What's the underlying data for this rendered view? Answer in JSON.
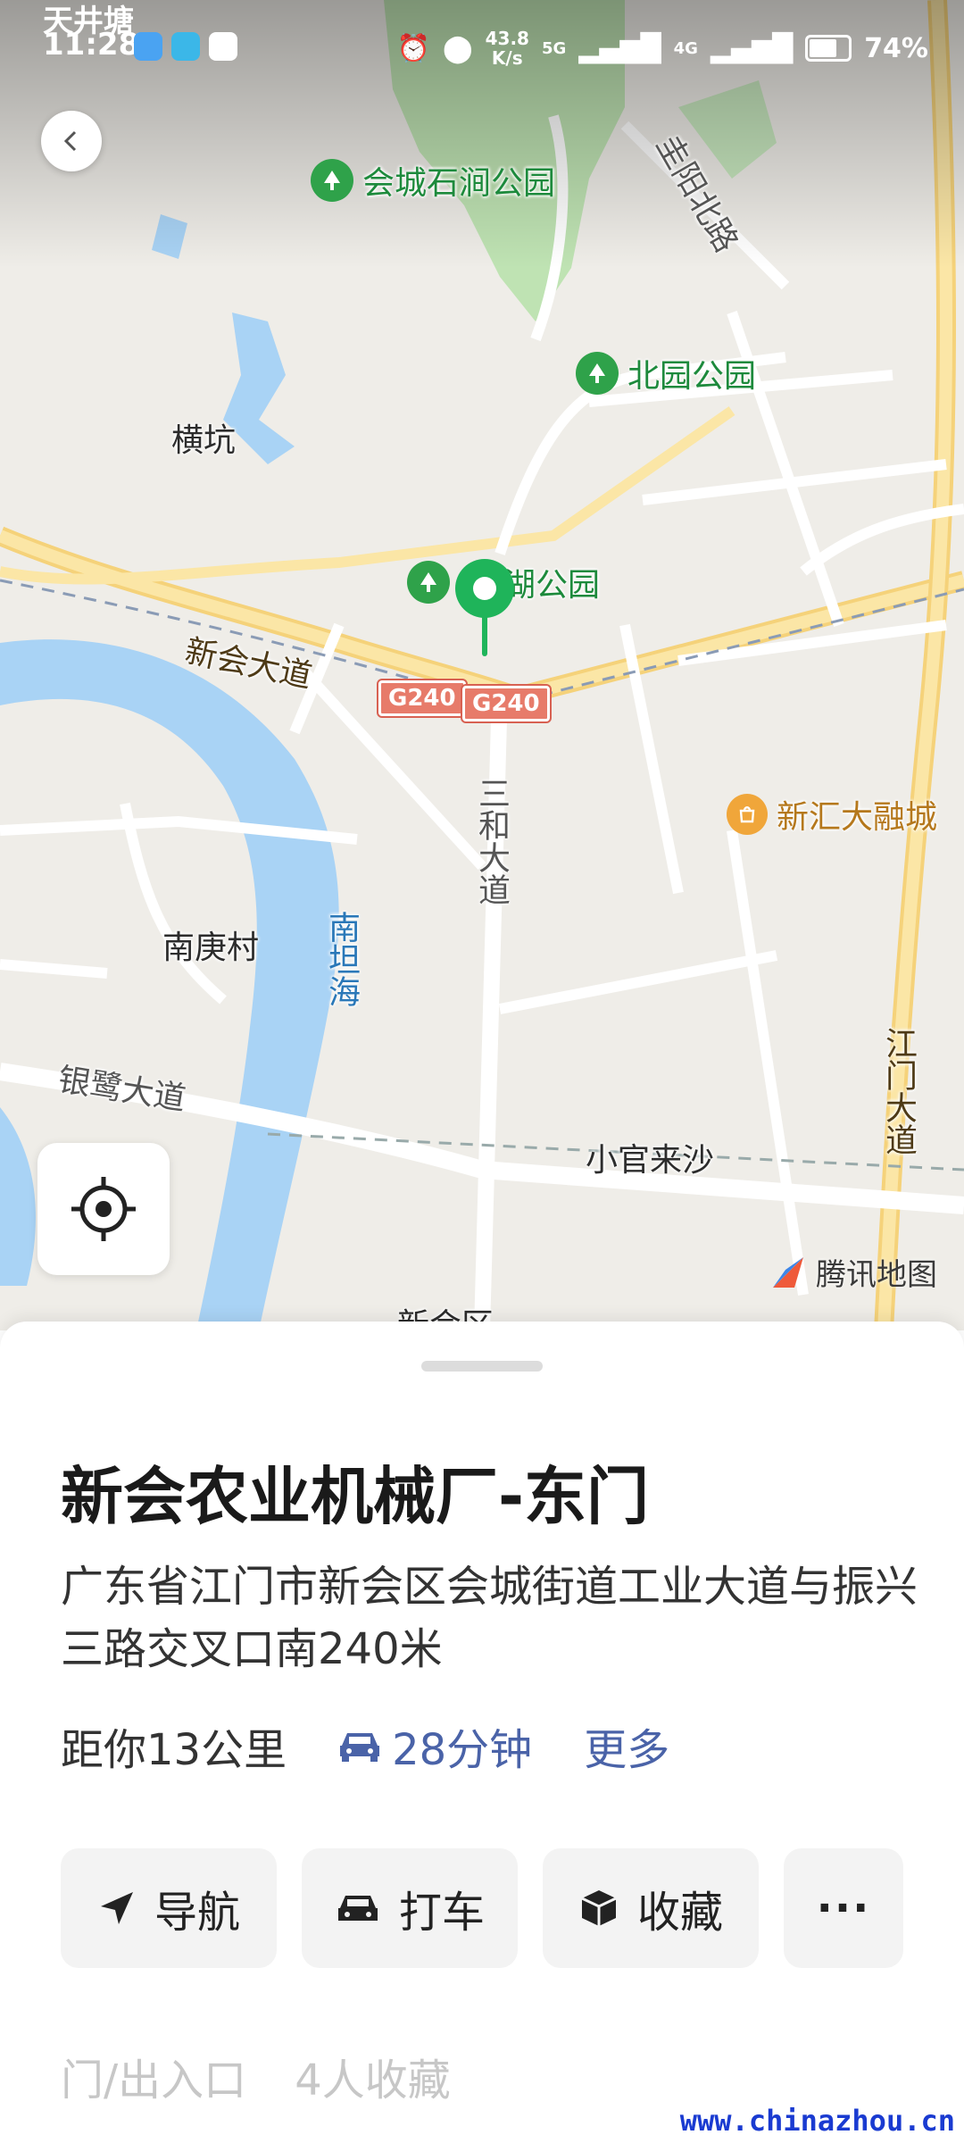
{
  "status_bar": {
    "carrier_area": "天井塘",
    "time": "11:28",
    "speed": "43.8",
    "speed_unit": "K/s",
    "net1": "5G",
    "net2": "4G",
    "battery": "74%"
  },
  "map": {
    "places": {
      "park1": "会城石涧公园",
      "park2": "北园公园",
      "park3": "湖公园",
      "village1": "横坑",
      "village2": "南庚村",
      "village3": "小官来沙",
      "district": "新会区",
      "poi_mall": "新汇大融城"
    },
    "roads": {
      "road1": "新会大道",
      "road2": "三和大道",
      "road3": "银鹭大道",
      "road4": "江门大道",
      "road5": "圭阳北路",
      "highway": "G240"
    },
    "water": "南坦海",
    "logo_text": "腾讯地图"
  },
  "place": {
    "title": "新会农业机械厂-东门",
    "address": "广东省江门市新会区会城街道工业大道与振兴三路交叉口南240米",
    "distance": "距你13公里",
    "drive_time": "28分钟",
    "more": "更多"
  },
  "actions": {
    "navigate": "导航",
    "taxi": "打车",
    "favorite": "收藏",
    "more": "···"
  },
  "footer": {
    "tab1": "门/出入口",
    "tab2": "4人收藏"
  },
  "watermark": "www.chinazhou.cn",
  "colors": {
    "accent_blue": "#4a63a8",
    "pin_green": "#1fb45a",
    "park_green": "#2fa24a",
    "water": "#a9d3f5"
  }
}
